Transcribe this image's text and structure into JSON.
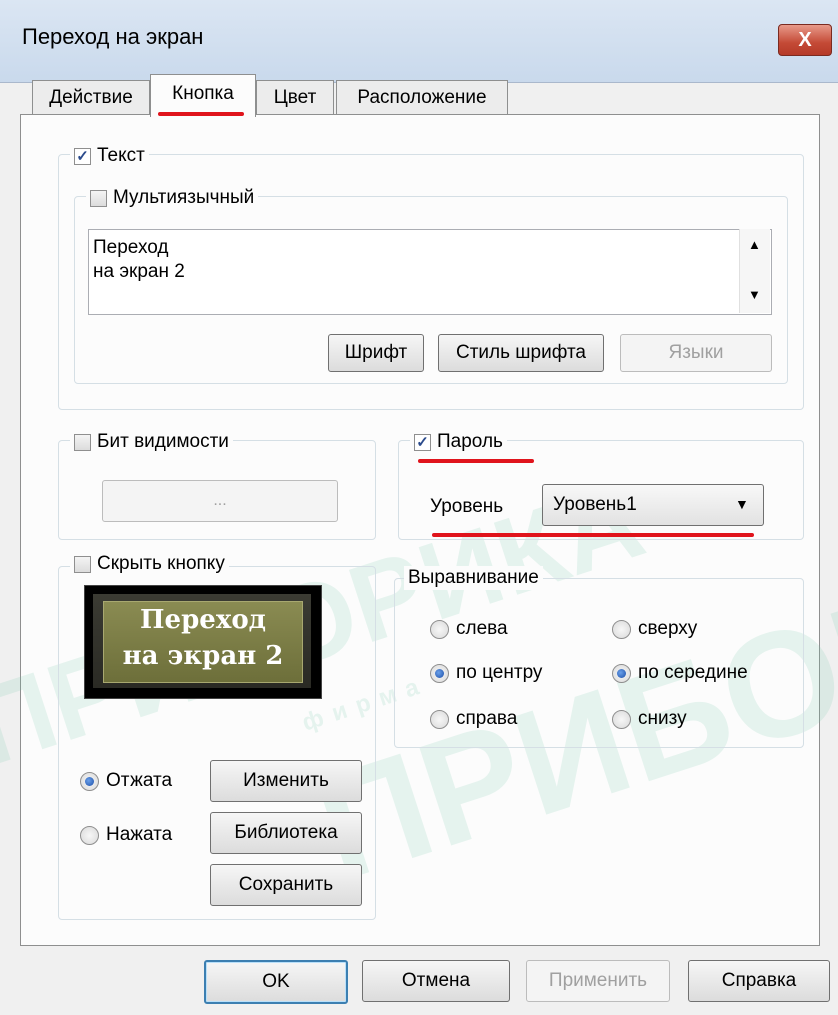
{
  "window": {
    "title": "Переход на экран",
    "close_label": "X"
  },
  "tabs": [
    {
      "label": "Действие",
      "active": false
    },
    {
      "label": "Кнопка",
      "active": true
    },
    {
      "label": "Цвет",
      "active": false
    },
    {
      "label": "Расположение",
      "active": false
    }
  ],
  "text_group": {
    "checkbox_label": "Текст",
    "checked": true,
    "multilingual": {
      "label": "Мультиязычный",
      "checked": false
    },
    "text_lines": [
      "Переход",
      "на экран 2"
    ],
    "buttons": {
      "font": "Шрифт",
      "font_style": "Стиль шрифта",
      "languages": "Языки"
    }
  },
  "visibility_bit": {
    "label": "Бит видимости",
    "checked": false,
    "button_label": "..."
  },
  "password": {
    "label": "Пароль",
    "checked": true,
    "level_label": "Уровень",
    "level_value": "Уровень1"
  },
  "hide_button": {
    "label": "Скрыть кнопку",
    "checked": false,
    "preview_lines": [
      "Переход",
      "на экран 2"
    ],
    "states": [
      {
        "label": "Отжата",
        "selected": true
      },
      {
        "label": "Нажата",
        "selected": false
      }
    ],
    "actions": {
      "change": "Изменить",
      "library": "Библиотека",
      "save": "Сохранить"
    }
  },
  "alignment": {
    "legend": "Выравнивание",
    "horizontal": [
      {
        "label": "слева",
        "selected": false
      },
      {
        "label": "по центру",
        "selected": true
      },
      {
        "label": "справа",
        "selected": false
      }
    ],
    "vertical": [
      {
        "label": "сверху",
        "selected": false
      },
      {
        "label": "по середине",
        "selected": true
      },
      {
        "label": "снизу",
        "selected": false
      }
    ]
  },
  "footer": {
    "ok": "OK",
    "cancel": "Отмена",
    "apply": "Применить",
    "help": "Справка"
  },
  "watermark": {
    "word_a": "ПРИБОРИКА",
    "word_b": "фирма"
  },
  "colors": {
    "annotation_underline": "#e0141c",
    "radio_selected": "#1d4fa8"
  }
}
